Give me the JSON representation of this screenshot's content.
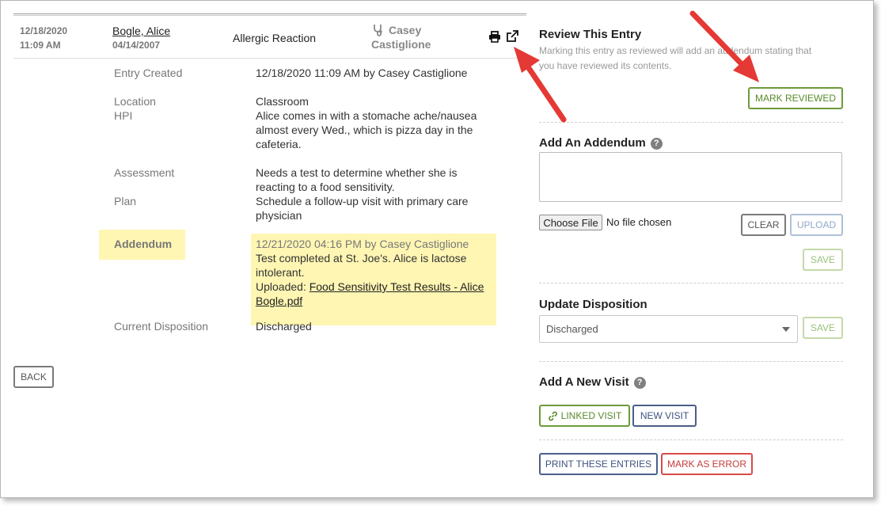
{
  "entry": {
    "date": "12/18/2020",
    "time": "11:09 AM",
    "patient_name": "Bogle, Alice",
    "patient_dob": "04/14/2007",
    "reason": "Allergic Reaction",
    "provider_first": "Casey",
    "provider_last": "Castiglione"
  },
  "details": {
    "entry_created_label": "Entry Created",
    "entry_created_value": "12/18/2020 11:09 AM by Casey Castiglione",
    "location_label": "Location",
    "location_value": "Classroom",
    "hpi_label": "HPI",
    "hpi_line1": "Alice comes in with a stomache ache/nausea",
    "hpi_line2": "almost every Wed., which is pizza day in the",
    "hpi_line3": "cafeteria.",
    "assessment_label": "Assessment",
    "assessment_line1": "Needs a test to determine whether she is",
    "assessment_line2": "reacting to a food sensitivity.",
    "plan_label": "Plan",
    "plan_line1": "Schedule a follow-up visit with primary care",
    "plan_line2": "physician",
    "addendum_label": "Addendum",
    "addendum_meta": "12/21/2020 04:16 PM by Casey Castiglione",
    "addendum_line1": "Test completed at St. Joe's. Alice is lactose",
    "addendum_line2": "intolerant.",
    "uploaded_label": "Uploaded:",
    "upload_link_line1": "Food Sensitivity Test Results - Alice",
    "upload_link_line2": "Bogle.pdf",
    "disposition_label": "Current Disposition",
    "disposition_value": "Discharged"
  },
  "back_label": "BACK",
  "review": {
    "title": "Review This Entry",
    "desc_line1": "Marking this entry as reviewed will add an addendum stating that",
    "desc_line2": "you have reviewed its contents.",
    "button": "MARK REVIEWED"
  },
  "addendum_section": {
    "title": "Add An Addendum",
    "textarea_value": "",
    "choose_file": "Choose File",
    "no_file": "No file chosen",
    "clear": "CLEAR",
    "upload": "UPLOAD",
    "save": "SAVE"
  },
  "disposition_section": {
    "title": "Update Disposition",
    "selected": "Discharged",
    "save": "SAVE"
  },
  "visit_section": {
    "title": "Add A New Visit",
    "linked_visit": "LINKED VISIT",
    "new_visit": "NEW VISIT"
  },
  "footer_actions": {
    "print": "PRINT THESE ENTRIES",
    "mark_error": "MARK AS ERROR"
  },
  "colors": {
    "highlight": "#fff6b3",
    "green": "#5a8a2a",
    "blue": "#3e5380",
    "red": "#c43c3c",
    "arrow": "#e53935"
  }
}
